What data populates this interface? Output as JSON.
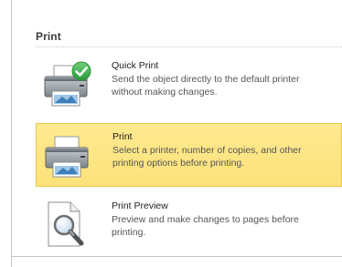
{
  "section": {
    "title": "Print"
  },
  "commands": [
    {
      "title": "Quick Print",
      "description": "Send the object directly to the default printer without making changes.",
      "icon": "quick-print-icon",
      "selected": false
    },
    {
      "title": "Print",
      "description": "Select a printer, number of copies, and other printing options before printing.",
      "icon": "printer-icon",
      "selected": true
    },
    {
      "title": "Print Preview",
      "description": "Preview and make changes to pages before printing.",
      "icon": "print-preview-icon",
      "selected": false
    }
  ],
  "colors": {
    "selected_background": "#fbe27a",
    "selected_border": "#e8c94a",
    "checkmark": "#3aa64a"
  }
}
